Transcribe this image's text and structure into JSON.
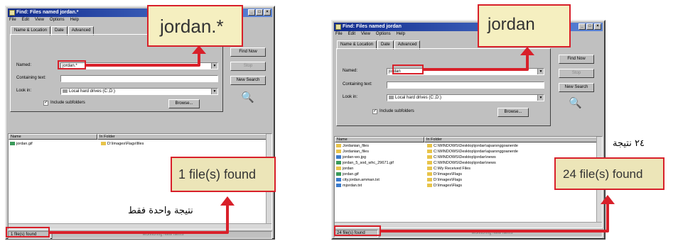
{
  "left": {
    "title": "Find: Files named jordan.*",
    "menu": [
      "File",
      "Edit",
      "View",
      "Options",
      "Help"
    ],
    "tabs": [
      "Name & Location",
      "Date",
      "Advanced"
    ],
    "named_label": "Named:",
    "named_value": "jordan.*",
    "containing_label": "Containing text:",
    "look_in_label": "Look in:",
    "look_in_value": "Local hard drives (C:,D:)",
    "include_subfolders": "Include subfolders",
    "browse": "Browse...",
    "find_now": "Find Now",
    "stop": "Stop",
    "new_search": "New Search",
    "col_name": "Name",
    "col_folder": "In Folder",
    "results": [
      {
        "name": "jordan.gif",
        "folder": "D:\\Images\\Flags\\files"
      }
    ],
    "status": "1 file(s) found",
    "status_right": "Monitoring New Items",
    "zoom_named": "jordan.*",
    "zoom_found": "1 file(s) found",
    "caption": "نتيجة واحدة فقط"
  },
  "right": {
    "title": "Find: Files named jordan",
    "menu": [
      "File",
      "Edit",
      "View",
      "Options",
      "Help"
    ],
    "tabs": [
      "Name & Location",
      "Date",
      "Advanced"
    ],
    "named_label": "Named:",
    "named_value": "jordan",
    "containing_label": "Containing text:",
    "look_in_label": "Look in:",
    "look_in_value": "Local hard drives (C:,D:)",
    "include_subfolders": "Include subfolders",
    "browse": "Browse...",
    "find_now": "Find Now",
    "stop": "Stop",
    "new_search": "New Search",
    "col_name": "Name",
    "col_folder": "In Folder",
    "results": [
      {
        "name": "Jordanian_files",
        "folder": "C:\\WINDOWS\\Desktop\\jordan\\ajsarsnggoanerde"
      },
      {
        "name": "Jordanian_files",
        "folder": "C:\\WINDOWS\\Desktop\\jordan\\ajsarsnggoanerde"
      },
      {
        "name": "jordan-wo.jpg",
        "folder": "C:\\WINDOWS\\Desktop\\jordan\\news"
      },
      {
        "name": "jordan_5_sod_whc_29671.gif",
        "folder": "C:\\WINDOWS\\Desktop\\jordan\\news"
      },
      {
        "name": "jordan",
        "folder": "C:\\My Received Files"
      },
      {
        "name": "jordan.gif",
        "folder": "D:\\Images\\Flags"
      },
      {
        "name": "city.jordan.amman.txt",
        "folder": "D:\\Images\\Flags"
      },
      {
        "name": "mjordan.txt",
        "folder": "D:\\Images\\Flags"
      }
    ],
    "status": "24 file(s) found",
    "status_right": "Monitoring New Items",
    "zoom_named": "jordan",
    "zoom_found": "24 file(s) found",
    "caption": "٢٤ نتيجة"
  },
  "colors": {
    "highlight_red": "#d8202a",
    "zoom_bg": "#f5efc0",
    "title_blue": "#102a8c"
  }
}
